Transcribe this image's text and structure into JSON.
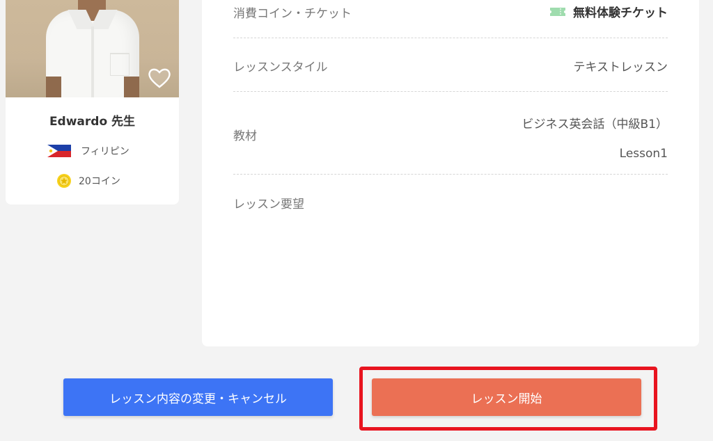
{
  "teacher": {
    "name": "Edwardo 先生",
    "country": "フィリピン",
    "coins": "20コイン",
    "flag_icon": "philippines-flag-icon",
    "coin_icon": "coin-icon",
    "favorite_icon": "heart-icon"
  },
  "lesson": {
    "rows": [
      {
        "label": "消費コイン・チケット",
        "value": "無料体験チケット",
        "icon": "ticket-icon"
      },
      {
        "label": "レッスンスタイル",
        "value": "テキストレッスン"
      },
      {
        "label": "教材",
        "value_line1": "ビジネス英会話（中級B1）",
        "value_line2": "Lesson1"
      },
      {
        "label": "レッスン要望",
        "value": ""
      }
    ]
  },
  "actions": {
    "change_cancel_label": "レッスン内容の変更・キャンセル",
    "start_label": "レッスン開始"
  },
  "colors": {
    "primary_blue": "#3d74f5",
    "start_orange": "#eb7054",
    "highlight_red": "#e8141f",
    "ticket_green": "#7fd19a"
  }
}
